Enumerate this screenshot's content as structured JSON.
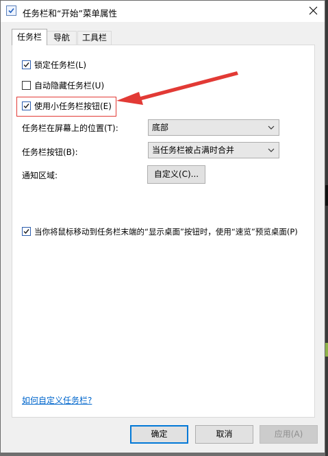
{
  "window": {
    "title": "任务栏和“开始”菜单属性",
    "close_glyph": "✕"
  },
  "tabs": [
    {
      "label": "任务栏",
      "active": true
    },
    {
      "label": "导航",
      "active": false
    },
    {
      "label": "工具栏",
      "active": false
    }
  ],
  "options": {
    "lock_taskbar": {
      "label": "锁定任务栏(L)",
      "checked": true
    },
    "auto_hide": {
      "label": "自动隐藏任务栏(U)",
      "checked": false
    },
    "small_buttons": {
      "label": "使用小任务栏按钮(E)",
      "checked": true
    },
    "peek": {
      "label": "当你将鼠标移动到任务栏末端的“显示桌面”按钮时，使用“速览”预览桌面(P)",
      "checked": true
    }
  },
  "position": {
    "label": "任务栏在屏幕上的位置(T):",
    "value": "底部"
  },
  "buttons_combine": {
    "label": "任务栏按钮(B):",
    "value": "当任务栏被占满时合并"
  },
  "notification": {
    "label": "通知区域:",
    "button": "自定义(C)..."
  },
  "help_link": "如何自定义任务栏?",
  "footer": {
    "ok": "确定",
    "cancel": "取消",
    "apply": "应用(A)"
  },
  "annotation": {
    "color": "#e23a35",
    "icon": "red-arrow"
  }
}
